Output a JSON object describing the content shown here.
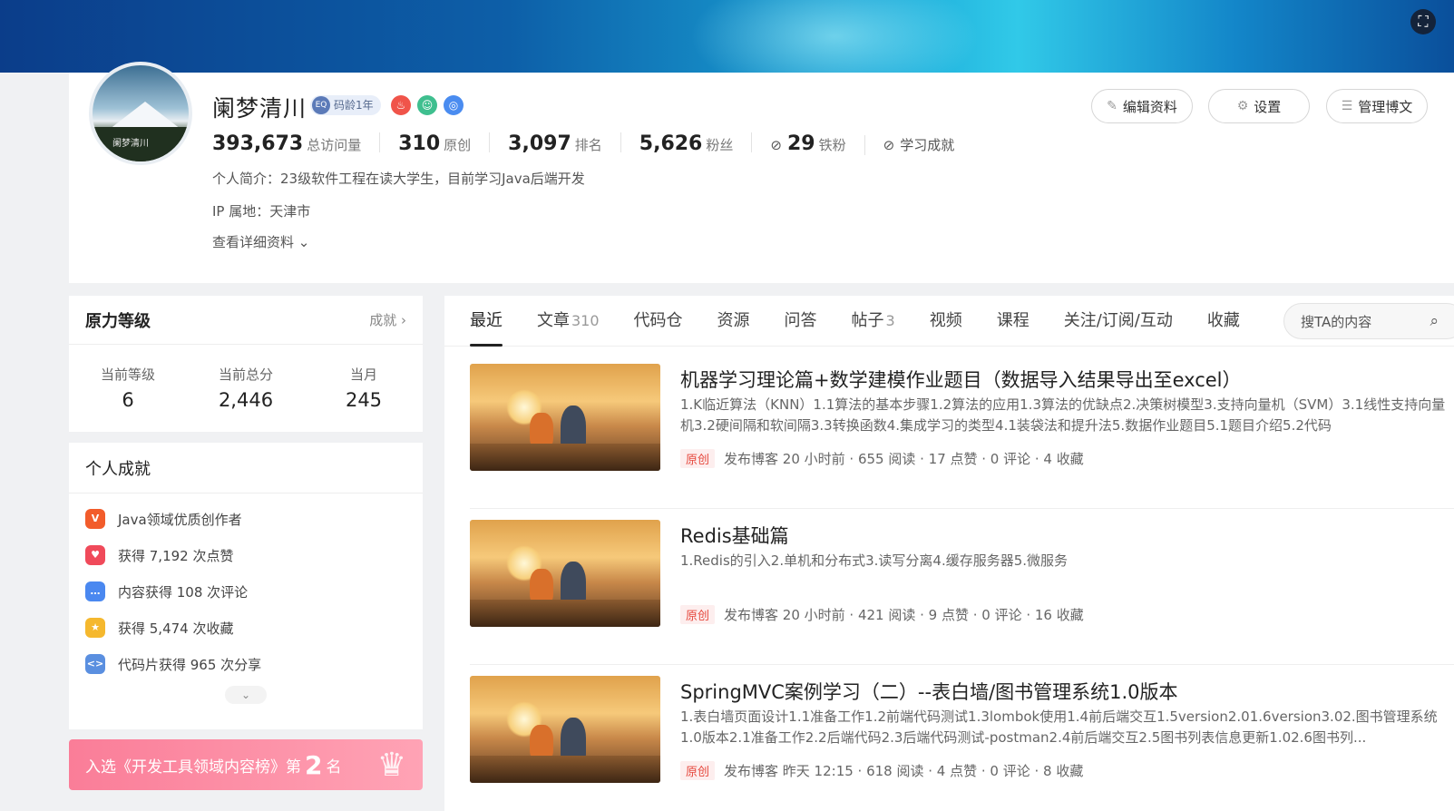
{
  "profile": {
    "name": "阑梦清川",
    "code_age": "码龄1年",
    "code_age_icon": "EQ",
    "avatar_text": "阑梦清川",
    "stats": [
      {
        "value": "393,673",
        "label": "总访问量"
      },
      {
        "value": "310",
        "label": "原创"
      },
      {
        "value": "3,097",
        "label": "排名"
      },
      {
        "value": "5,626",
        "label": "粉丝"
      },
      {
        "value": "29",
        "label": "铁粉"
      },
      {
        "value": "",
        "label": "学习成就"
      }
    ],
    "intro": "个人简介：23级软件工程在读大学生，目前学习Java后端开发",
    "ip": "IP 属地：天津市",
    "detail_link": "查看详细资料",
    "buttons": {
      "edit": "编辑资料",
      "settings": "设置",
      "manage": "管理博文"
    }
  },
  "power": {
    "title": "原力等级",
    "link": "成就",
    "levels": [
      {
        "label": "当前等级",
        "value": "6"
      },
      {
        "label": "当前总分",
        "value": "2,446"
      },
      {
        "label": "当月",
        "value": "245"
      }
    ]
  },
  "achievements": {
    "title": "个人成就",
    "items": [
      {
        "icon": "V",
        "color": "#f25c2b",
        "text": "Java领域优质创作者"
      },
      {
        "icon": "♥",
        "color": "#f04a5a",
        "text": "获得 7,192 次点赞"
      },
      {
        "icon": "…",
        "color": "#4a88f0",
        "text": "内容获得 108 次评论"
      },
      {
        "icon": "★",
        "color": "#f5b82e",
        "text": "获得 5,474 次收藏"
      },
      {
        "icon": "<>",
        "color": "#5a8fe0",
        "text": "代码片获得 965 次分享"
      }
    ]
  },
  "rank_banner": {
    "prefix": "入选《开发工具领域内容榜》第",
    "rank": "2",
    "suffix": "名"
  },
  "tabs": [
    {
      "label": "最近",
      "count": "",
      "active": true
    },
    {
      "label": "文章",
      "count": "310"
    },
    {
      "label": "代码仓",
      "count": ""
    },
    {
      "label": "资源",
      "count": ""
    },
    {
      "label": "问答",
      "count": ""
    },
    {
      "label": "帖子",
      "count": "3"
    },
    {
      "label": "视频",
      "count": ""
    },
    {
      "label": "课程",
      "count": ""
    },
    {
      "label": "关注/订阅/互动",
      "count": ""
    },
    {
      "label": "收藏",
      "count": ""
    }
  ],
  "search": {
    "placeholder": "搜TA的内容"
  },
  "articles": [
    {
      "title": "机器学习理论篇+数学建模作业题目（数据导入结果导出至excel）",
      "desc": "1.K临近算法（KNN）1.1算法的基本步骤1.2算法的应用1.3算法的优缺点2.决策树模型3.支持向量机（SVM）3.1线性支持向量机3.2硬间隔和软间隔3.3转换函数4.集成学习的类型4.1装袋法和提升法5.数据作业题目5.1题目介绍5.2代码",
      "tag": "原创",
      "meta": "发布博客 20 小时前 · 655 阅读 · 17 点赞 · 0 评论 · 4 收藏"
    },
    {
      "title": "Redis基础篇",
      "desc": "1.Redis的引入2.单机和分布式3.读写分离4.缓存服务器5.微服务",
      "tag": "原创",
      "meta": "发布博客 20 小时前 · 421 阅读 · 9 点赞 · 0 评论 · 16 收藏"
    },
    {
      "title": "SpringMVC案例学习（二）--表白墙/图书管理系统1.0版本",
      "desc": "1.表白墙页面设计1.1准备工作1.2前端代码测试1.3lombok使用1.4前后端交互1.5version2.01.6version3.02.图书管理系统1.0版本2.1准备工作2.2后端代码2.3后端代码测试-postman2.4前后端交互2.5图书列表信息更新1.02.6图书列...",
      "tag": "原创",
      "meta": "发布博客 昨天 12:15 · 618 阅读 · 4 点赞 · 0 评论 · 8 收藏"
    }
  ]
}
